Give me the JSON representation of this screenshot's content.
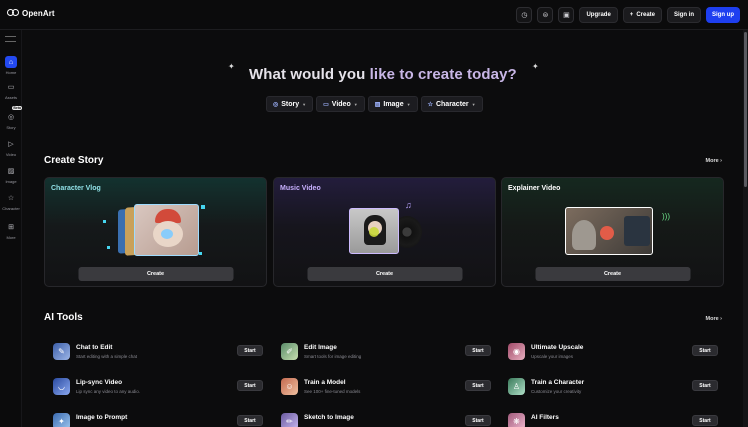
{
  "brand": {
    "name": "OpenArt"
  },
  "topbar": {
    "icons": [
      "clock-icon",
      "gamepad-icon",
      "image-icon"
    ],
    "upgrade_label": "Upgrade",
    "create_label": "Create",
    "signin_label": "Sign in",
    "signup_label": "Sign up",
    "signup_color": "#1e3ff0"
  },
  "sidebar": {
    "items": [
      {
        "label": "Home",
        "icon": "home-icon",
        "active": true
      },
      {
        "label": "Assets",
        "icon": "folder-icon"
      },
      {
        "label": "Story",
        "icon": "story-icon",
        "badge": "Beta"
      },
      {
        "label": "Video",
        "icon": "video-icon"
      },
      {
        "label": "Image",
        "icon": "image-icon"
      },
      {
        "label": "Character",
        "icon": "star-icon"
      },
      {
        "label": "More",
        "icon": "grid-icon"
      }
    ]
  },
  "hero": {
    "title_a": "What would you ",
    "title_b": "like to create today?",
    "pills": [
      {
        "label": "Story",
        "icon": "story-icon"
      },
      {
        "label": "Video",
        "icon": "video-icon"
      },
      {
        "label": "Image",
        "icon": "image-icon"
      },
      {
        "label": "Character",
        "icon": "star-icon"
      }
    ]
  },
  "create_story": {
    "title": "Create Story",
    "more_label": "More ›",
    "cards": [
      {
        "title": "Character Vlog",
        "button": "Create",
        "title_color": "#8fe0e6"
      },
      {
        "title": "Music Video",
        "button": "Create",
        "title_color": "#c8b0ff"
      },
      {
        "title": "Explainer Video",
        "button": "Create",
        "title_color": "#ffffff"
      }
    ]
  },
  "ai_tools": {
    "title": "AI Tools",
    "more_label": "More ›",
    "start_label": "Start",
    "tools": [
      {
        "title": "Chat to Edit",
        "desc": "Start editing with a simple chat",
        "icon": "chat-icon"
      },
      {
        "title": "Edit Image",
        "desc": "Smart tools for image editing",
        "icon": "brush-icon"
      },
      {
        "title": "Ultimate Upscale",
        "desc": "Upscale your images",
        "icon": "upscale-icon"
      },
      {
        "title": "Lip-sync Video",
        "desc": "Lip sync any video to any audio.",
        "icon": "lips-icon"
      },
      {
        "title": "Train a Model",
        "desc": "See 100+ fine-tuned models",
        "icon": "model-icon"
      },
      {
        "title": "Train a Character",
        "desc": "Customize your creativity",
        "icon": "character-icon"
      },
      {
        "title": "Image to Prompt",
        "desc": "",
        "icon": "prompt-icon"
      },
      {
        "title": "Sketch to Image",
        "desc": "",
        "icon": "sketch-icon"
      },
      {
        "title": "AI Filters",
        "desc": "",
        "icon": "filter-icon"
      }
    ]
  }
}
